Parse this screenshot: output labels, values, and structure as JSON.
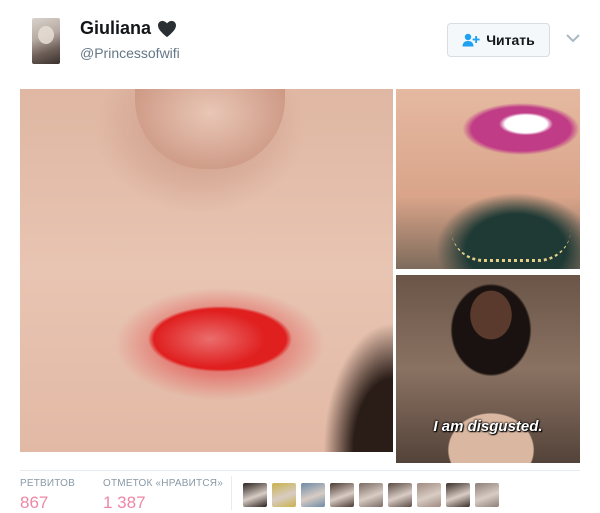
{
  "user": {
    "name": "Giuliana",
    "handle": "@Princessofwifi"
  },
  "follow": {
    "label": "Читать"
  },
  "media": {
    "caption": "I am disgusted."
  },
  "stats": {
    "retweets_label": "РЕТВИТОВ",
    "retweets_value": "867",
    "likes_label": "ОТМЕТОК «НРАВИТСЯ»",
    "likes_value": "1 387"
  },
  "colors": {
    "likes": "#e0245e",
    "handle": "#657786"
  },
  "icons": [
    "black-heart-icon",
    "follow-person-icon",
    "chevron-down-icon"
  ],
  "liker_colors": [
    "#2b2320",
    "#c9b24a",
    "#6d8aa6",
    "#4b3a33",
    "#7a6a63",
    "#5b4a44",
    "#a08a80",
    "#3a2f2a",
    "#8c7f78"
  ]
}
